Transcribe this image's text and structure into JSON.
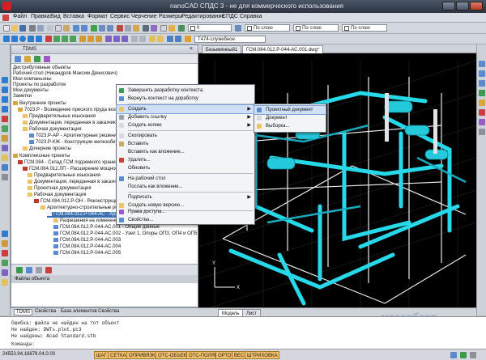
{
  "window": {
    "title": "nanoCAD СПДС 3 - не для коммерческого использования"
  },
  "menubar": {
    "items": [
      "Файл",
      "Правка",
      "Вид",
      "Вставка",
      "Формат",
      "Сервис",
      "Черчение",
      "Размеры",
      "Редактирование",
      "СПДС",
      "Справка"
    ]
  },
  "toolbar": {
    "combo_color": "По слою",
    "combo_linetype": "По слою",
    "combo_layer": "0",
    "combo_lineweight": "По слою",
    "layer_name": "Т474-служебное"
  },
  "tree": {
    "header": "TDMS",
    "items": [
      "Дистрибутивные объекты",
      "Рабочий стол (Никандров Максим Денисович)",
      "Мои компаньоны",
      "Проекты по разработке",
      "Мои документы",
      "Заметки",
      "Внутренние проекты",
      "7023.Р - Возведение пресного пруда возле",
      "Предварительные изыскания",
      "Документация, переданная в заказчику",
      "Рабочая документация",
      "7023.Р-АР - Архитектурные решения",
      "7023.Р-КЖ - Конструкции железобетонные",
      "Дочерние проекты",
      "Комплексные проекты",
      "ГСМ.084 - Склад ГСМ подземного хранения",
      "ГСМ.084.012.ЛП - Расширение мощности",
      "Предварительные изыскания",
      "Документация, переданная в заказчику",
      "Проектная документация",
      "Рабочая документация",
      "ГСМ.084.012.Р-ОН - Реконструкция",
      "Архитектурно-строительные решения",
      "ГСМ.084.012.Р-044-АС - Архитектурно-строительные решения",
      "Разрешения на изменение",
      "ГСМ.084.012.Р-044-АС.001 - Общие данные",
      "ГСМ.084.012.Р-044-АС.002 - Узел 1. Опоры ОПЗ, ОП4 и ОП5",
      "ГСМ.084.012.Р-044-АС.003",
      "ГСМ.084.012.Р-044-АС.004",
      "ГСМ.084.012.Р-044-АС.005"
    ],
    "object_label": "Файлы объекта"
  },
  "panel_tabs": [
    "TDMS",
    "Свойства",
    "База элементов",
    "Свойства"
  ],
  "doc_tabs": [
    "Безымянный1",
    "ГСМ.084.012.Р-044-АС.001.dwg*"
  ],
  "layout_tabs": [
    "Модель",
    "Лист"
  ],
  "context_menu": {
    "items": [
      "Завершить разработку контекста",
      "Вернуть контекст на доработку",
      "Создать",
      "Добавить ссылку",
      "Создать копию",
      "Скопировать",
      "Вставить",
      "Вставить как вложение...",
      "Удалить...",
      "Обновить",
      "На рабочий стол",
      "Послать как вложение...",
      "Подписать",
      "Создать новую версию...",
      "Права доступа...",
      "Свойства..."
    ]
  },
  "submenu": {
    "items": [
      "Проектный документ",
      "Документ",
      "Выборка..."
    ]
  },
  "command_line": {
    "lines": [
      "Ошибка: файла не найден на тот объект",
      "Не найден: DWTs.plot.pc3",
      "Не найдены: Acad Standard.stb"
    ],
    "prompt": "Команда:"
  },
  "status": {
    "coords": "24553.94,16879.04,0.00",
    "buttons": [
      "ШАГ",
      "СЕТКА",
      "ОПРИВЯЗКА",
      "ОТС-ОБЪЕКТ",
      "ОТС-ПОЛЯР",
      "ОРТО",
      "ВЕС",
      "ШТРИХОВКА"
    ]
  },
  "watermark": "мегаобзор"
}
